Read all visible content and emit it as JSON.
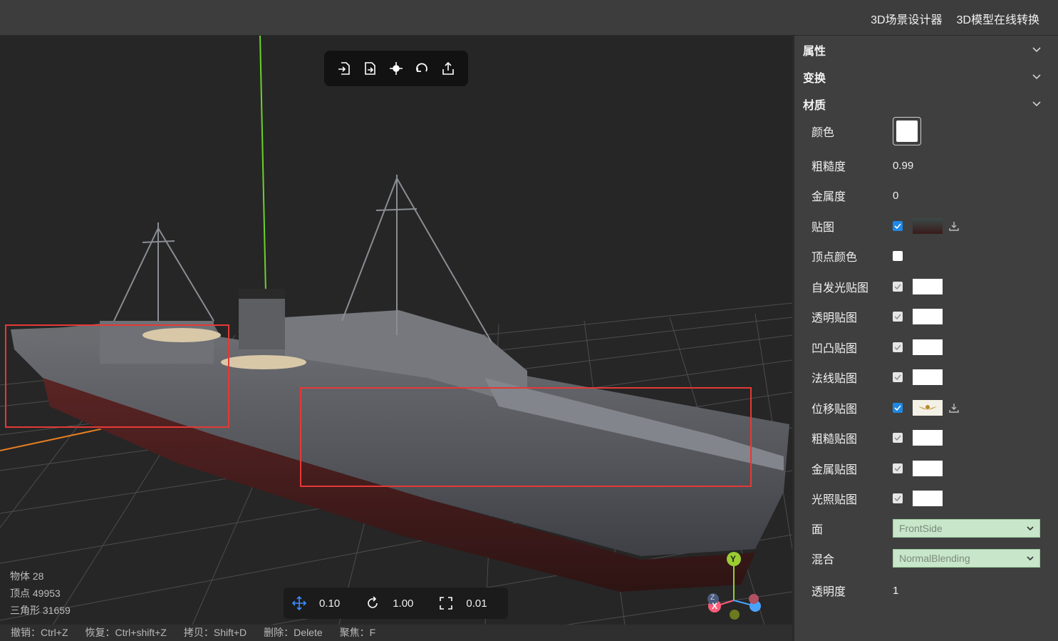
{
  "header": {
    "nav": [
      "3D场景设计器",
      "3D模型在线转换"
    ]
  },
  "toolbar": {
    "icons": [
      "import-icon",
      "replace-icon",
      "focus-icon",
      "reset-icon",
      "export-icon"
    ]
  },
  "stats": {
    "objects": "物体 28",
    "vertices": "顶点 49953",
    "triangles": "三角形 31659"
  },
  "snap": {
    "translate": "0.10",
    "rotate": "1.00",
    "scale": "0.01"
  },
  "shortcuts": [
    "撤销：Ctrl+Z",
    "恢复：Ctrl+shift+Z",
    "拷贝：Shift+D",
    "删除：Delete",
    "聚焦：F"
  ],
  "gizmo": {
    "y": "Y",
    "x": "X",
    "z": "Z"
  },
  "panel": {
    "sections": [
      "属性",
      "变换",
      "材质"
    ],
    "material": {
      "color_label": "颜色",
      "roughness_label": "粗糙度",
      "roughness": "0.99",
      "metalness_label": "金属度",
      "metalness": "0",
      "map_label": "贴图",
      "vertex_colors_label": "顶点颜色",
      "emissive_map_label": "自发光贴图",
      "alpha_map_label": "透明贴图",
      "bump_map_label": "凹凸贴图",
      "normal_map_label": "法线贴图",
      "displacement_map_label": "位移贴图",
      "roughness_map_label": "粗糙贴图",
      "metalness_map_label": "金属贴图",
      "light_map_label": "光照贴图",
      "side_label": "面",
      "side": "FrontSide",
      "blending_label": "混合",
      "blending": "NormalBlending",
      "opacity_label": "透明度",
      "opacity": "1"
    }
  },
  "colors": {
    "accent": "#1e88e5",
    "highlight": "#e53935",
    "select_bg": "#c8e6c9"
  }
}
